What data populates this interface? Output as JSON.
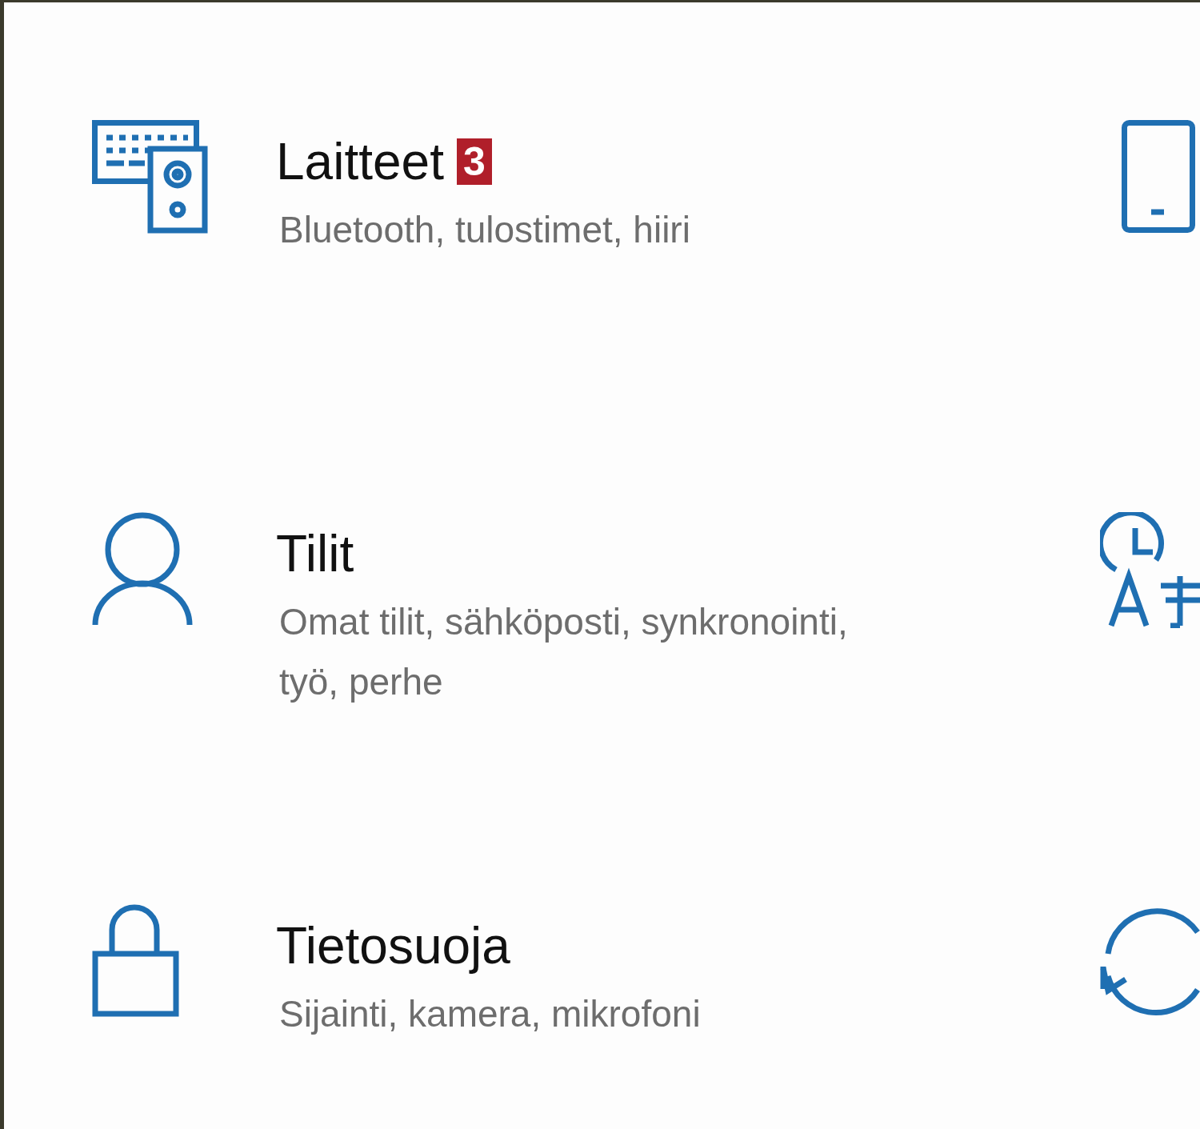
{
  "items": [
    {
      "kind": "devices",
      "title": "Laitteet",
      "badge": "3",
      "subtitle": "Bluetooth, tulostimet, hiiri"
    },
    {
      "kind": "accounts",
      "title": "Tilit",
      "subtitle": "Omat tilit, sähköposti, synkronointi, työ, perhe"
    },
    {
      "kind": "privacy",
      "title": "Tietosuoja",
      "subtitle": "Sijainti, kamera, mikrofoni"
    }
  ],
  "next_column": [
    {
      "kind": "phone"
    },
    {
      "kind": "time-language"
    },
    {
      "kind": "update"
    }
  ]
}
